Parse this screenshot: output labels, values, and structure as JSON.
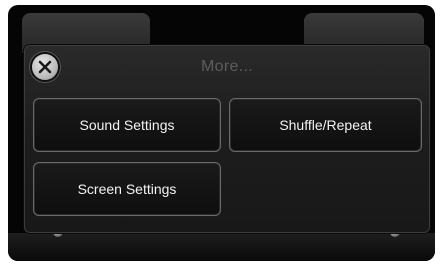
{
  "dialog": {
    "title": "More...",
    "close_icon": "close-x-icon"
  },
  "buttons": {
    "sound_settings": "Sound Settings",
    "shuffle_repeat": "Shuffle/Repeat",
    "screen_settings": "Screen Settings"
  },
  "colors": {
    "background": "#050505",
    "panel": "#1e1e1e",
    "button_border": "#6a6a6a",
    "button_text": "#f2f2f2",
    "title_text": "#5c5c5c"
  }
}
